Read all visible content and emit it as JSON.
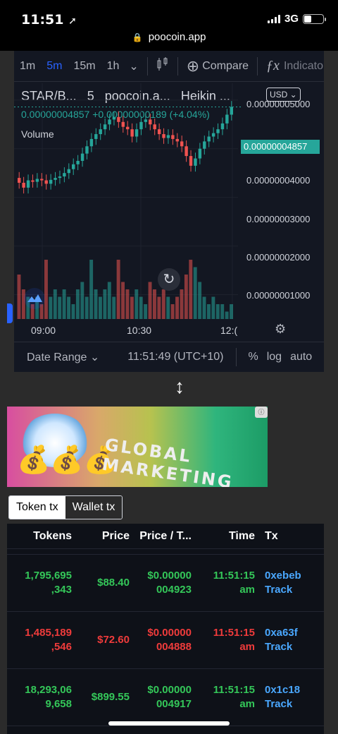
{
  "status_bar": {
    "time": "11:51",
    "location_glyph": "➚",
    "network": "3G"
  },
  "browser": {
    "url": "poocoin.app"
  },
  "chart_toolbar": {
    "timeframes": [
      "1m",
      "5m",
      "15m",
      "1h"
    ],
    "active_timeframe": "5m",
    "compare_label": "Compare",
    "indicators_label": "Indicato"
  },
  "chart_legend": {
    "symbol": "STAR/B...",
    "interval": "5",
    "source": "poocoin.a...",
    "style": "Heikin ...",
    "price_line": "0.00000004857 +0.00000000189 (+4.04%)",
    "volume_label": "Volume"
  },
  "chart": {
    "currency_button": "USD",
    "current_price_tag": "0.00000004857",
    "accent_up": "#26a69a",
    "accent_down": "#ef5350"
  },
  "chart_data": {
    "type": "candlestick",
    "y_ticks": [
      "0.00000005000",
      "0.00000004000",
      "0.00000003000",
      "0.00000002000",
      "0.00000001000"
    ],
    "x_ticks": [
      "09:00",
      "10:30",
      "12:("
    ],
    "ylim": [
      5e-09,
      5.2e-08
    ],
    "candles": [
      {
        "o": 3.4e-08,
        "c": 3.3e-08,
        "v": 6
      },
      {
        "o": 3.3e-08,
        "c": 3.2e-08,
        "v": 4
      },
      {
        "o": 3.2e-08,
        "c": 3.35e-08,
        "v": 3
      },
      {
        "o": 3.35e-08,
        "c": 3.32e-08,
        "v": 2
      },
      {
        "o": 3.32e-08,
        "c": 3.38e-08,
        "v": 3
      },
      {
        "o": 3.38e-08,
        "c": 3.35e-08,
        "v": 2
      },
      {
        "o": 3.35e-08,
        "c": 3.28e-08,
        "v": 8
      },
      {
        "o": 3.28e-08,
        "c": 3.36e-08,
        "v": 3
      },
      {
        "o": 3.36e-08,
        "c": 3.4e-08,
        "v": 4
      },
      {
        "o": 3.4e-08,
        "c": 3.43e-08,
        "v": 3
      },
      {
        "o": 3.43e-08,
        "c": 3.5e-08,
        "v": 4
      },
      {
        "o": 3.5e-08,
        "c": 3.58e-08,
        "v": 3
      },
      {
        "o": 3.58e-08,
        "c": 3.68e-08,
        "v": 2
      },
      {
        "o": 3.68e-08,
        "c": 3.75e-08,
        "v": 4
      },
      {
        "o": 3.75e-08,
        "c": 3.9e-08,
        "v": 5
      },
      {
        "o": 3.9e-08,
        "c": 4.05e-08,
        "v": 3
      },
      {
        "o": 4.05e-08,
        "c": 4.2e-08,
        "v": 8
      },
      {
        "o": 4.2e-08,
        "c": 4.3e-08,
        "v": 4
      },
      {
        "o": 4.3e-08,
        "c": 4.4e-08,
        "v": 3
      },
      {
        "o": 4.4e-08,
        "c": 4.5e-08,
        "v": 4
      },
      {
        "o": 4.5e-08,
        "c": 4.6e-08,
        "v": 5
      },
      {
        "o": 4.6e-08,
        "c": 4.65e-08,
        "v": 3
      },
      {
        "o": 4.65e-08,
        "c": 4.55e-08,
        "v": 8
      },
      {
        "o": 4.55e-08,
        "c": 4.45e-08,
        "v": 5
      },
      {
        "o": 4.45e-08,
        "c": 4.4e-08,
        "v": 4
      },
      {
        "o": 4.4e-08,
        "c": 4.25e-08,
        "v": 3
      },
      {
        "o": 4.25e-08,
        "c": 4.4e-08,
        "v": 4
      },
      {
        "o": 4.4e-08,
        "c": 4.55e-08,
        "v": 3
      },
      {
        "o": 4.55e-08,
        "c": 4.6e-08,
        "v": 2
      },
      {
        "o": 4.6e-08,
        "c": 4.5e-08,
        "v": 5
      },
      {
        "o": 4.5e-08,
        "c": 4.4e-08,
        "v": 4
      },
      {
        "o": 4.4e-08,
        "c": 4.3e-08,
        "v": 3
      },
      {
        "o": 4.3e-08,
        "c": 4.22e-08,
        "v": 4
      },
      {
        "o": 4.22e-08,
        "c": 4.28e-08,
        "v": 3
      },
      {
        "o": 4.28e-08,
        "c": 4.2e-08,
        "v": 2
      },
      {
        "o": 4.2e-08,
        "c": 4.15e-08,
        "v": 3
      },
      {
        "o": 4.15e-08,
        "c": 4.05e-08,
        "v": 4
      },
      {
        "o": 4.05e-08,
        "c": 3.85e-08,
        "v": 6
      },
      {
        "o": 3.85e-08,
        "c": 3.65e-08,
        "v": 8
      },
      {
        "o": 3.65e-08,
        "c": 3.8e-08,
        "v": 7
      },
      {
        "o": 3.8e-08,
        "c": 4e-08,
        "v": 5
      },
      {
        "o": 4e-08,
        "c": 4.15e-08,
        "v": 3
      },
      {
        "o": 4.15e-08,
        "c": 4.25e-08,
        "v": 2
      },
      {
        "o": 4.25e-08,
        "c": 4.32e-08,
        "v": 3
      },
      {
        "o": 4.32e-08,
        "c": 4.4e-08,
        "v": 2
      },
      {
        "o": 4.4e-08,
        "c": 4.52e-08,
        "v": 2
      },
      {
        "o": 4.52e-08,
        "c": 4.7e-08,
        "v": 1
      },
      {
        "o": 4.7e-08,
        "c": 4.86e-08,
        "v": 2
      }
    ]
  },
  "chart_bottom": {
    "date_range": "Date Range",
    "clock": "11:51:49 (UTC+10)",
    "percent": "%",
    "log": "log",
    "auto": "auto"
  },
  "tx_tabs": {
    "token_tx": "Token tx",
    "wallet_tx": "Wallet tx"
  },
  "tx_table": {
    "headers": {
      "tokens": "Tokens",
      "price": "Price",
      "price_token": "Price / T...",
      "time": "Time",
      "tx": "Tx"
    },
    "rows": [
      {
        "side": "buy",
        "tokens_1": "1,795,695",
        "tokens_2": ",343",
        "price": "$88.40",
        "pt_1": "$0.00000",
        "pt_2": "004923",
        "time_1": "11:51:15",
        "time_2": "am",
        "tx_1": "0xebeb",
        "tx_2": "Track"
      },
      {
        "side": "sell",
        "tokens_1": "1,485,189",
        "tokens_2": ",546",
        "price": "$72.60",
        "pt_1": "$0.00000",
        "pt_2": "004888",
        "time_1": "11:51:15",
        "time_2": "am",
        "tx_1": "0xa63f",
        "tx_2": "Track"
      },
      {
        "side": "buy",
        "tokens_1": "18,293,06",
        "tokens_2": "9,658",
        "price": "$899.55",
        "pt_1": "$0.00000",
        "pt_2": "004917",
        "time_1": "11:51:15",
        "time_2": "am",
        "tx_1": "0x1c18",
        "tx_2": "Track"
      }
    ]
  }
}
